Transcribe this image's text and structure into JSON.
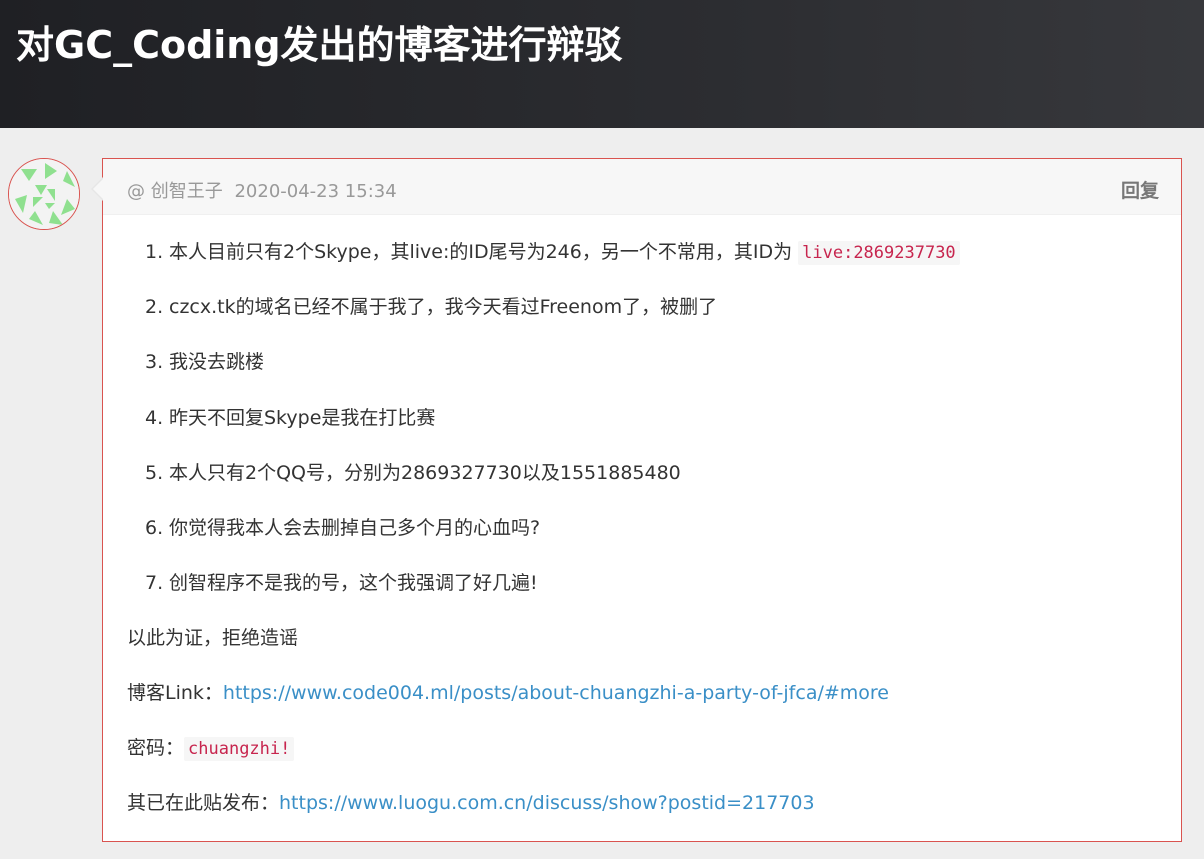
{
  "header": {
    "title": "对GC_Coding发出的博客进行辩驳"
  },
  "comment": {
    "at_symbol": "@",
    "author": "创智王子",
    "date": "2020-04-23 15:34",
    "reply_label": "回复",
    "items": [
      {
        "num": "1.",
        "text": "本人目前只有2个Skype，其live:的ID尾号为246，另一个不常用，其ID为 ",
        "code": "live:2869237730"
      },
      {
        "num": "2.",
        "text": "czcx.tk的域名已经不属于我了，我今天看过Freenom了，被删了"
      },
      {
        "num": "3.",
        "text": "我没去跳楼"
      },
      {
        "num": "4.",
        "text": "昨天不回复Skype是我在打比赛"
      },
      {
        "num": "5.",
        "text": "本人只有2个QQ号，分别为2869327730以及1551885480"
      },
      {
        "num": "6.",
        "text": "你觉得我本人会去删掉自己多个月的心血吗?"
      },
      {
        "num": "7.",
        "text": "创智程序不是我的号，这个我强调了好几遍!"
      }
    ],
    "statement": "以此为证，拒绝造谣",
    "blog_label": "博客Link：",
    "blog_url": "https://www.code004.ml/posts/about-chuangzhi-a-party-of-jfca/#more",
    "password_label": "密码：",
    "password": "chuangzhi!",
    "posted_label": "其已在此贴发布：",
    "posted_url": "https://www.luogu.com.cn/discuss/show?postid=217703"
  },
  "colors": {
    "header_bg": "#2c2d31",
    "card_border": "#d9534f",
    "link": "#3a8fc7",
    "code_text": "#c7254e",
    "avatar_green": "#8fe08f"
  },
  "icons": {
    "avatar": "identicon-avatar"
  }
}
